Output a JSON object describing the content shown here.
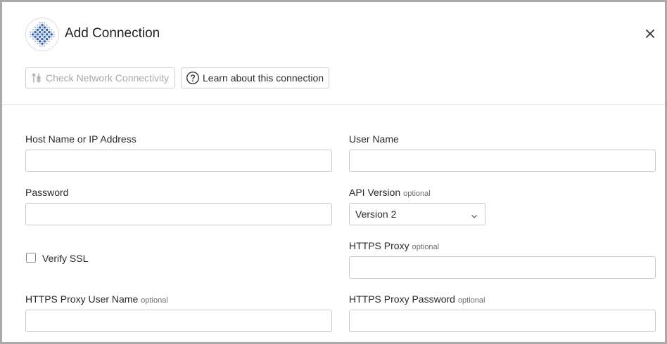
{
  "dialog": {
    "title": "Add Connection",
    "logo_icon": "checker-dots-logo-icon",
    "close_icon": "close-icon"
  },
  "toolbar": {
    "check_label": "Check Network Connectivity",
    "check_icon": "network-icon",
    "learn_label": "Learn about this connection",
    "learn_icon": "help-circle-icon"
  },
  "form": {
    "optional_tag": "optional",
    "host": {
      "label": "Host Name or IP Address",
      "value": ""
    },
    "user": {
      "label": "User Name",
      "value": ""
    },
    "password": {
      "label": "Password",
      "value": ""
    },
    "api_version": {
      "label": "API Version",
      "value": "Version 2"
    },
    "verify_ssl": {
      "label": "Verify SSL",
      "checked": false
    },
    "https_proxy": {
      "label": "HTTPS Proxy",
      "value": ""
    },
    "proxy_user": {
      "label": "HTTPS Proxy User Name",
      "value": ""
    },
    "proxy_password": {
      "label": "HTTPS Proxy Password",
      "value": ""
    }
  },
  "colors": {
    "logo_blue": "#2f5fa8",
    "disabled_text": "#a8a8a8",
    "border": "#c9c9c9"
  }
}
